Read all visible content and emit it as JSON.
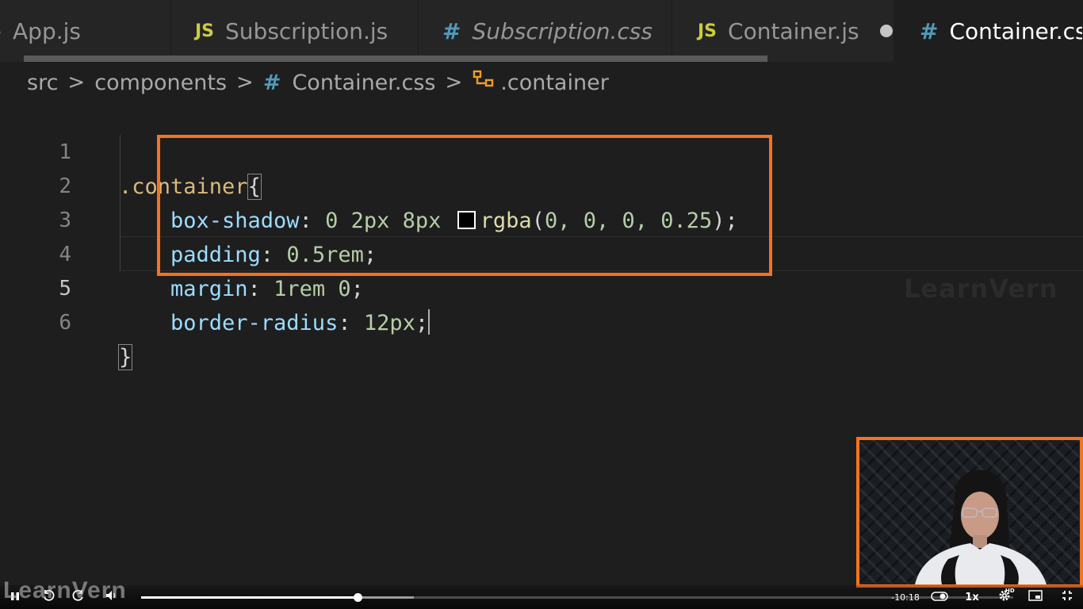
{
  "tabs": [
    {
      "label": "App.js",
      "icon": "js-file-icon",
      "icon_text": "JS",
      "italic": false,
      "active": false,
      "dirty": false
    },
    {
      "label": "Subscription.js",
      "icon": "js-file-icon",
      "icon_text": "JS",
      "italic": false,
      "active": false,
      "dirty": false
    },
    {
      "label": "Subscription.css",
      "icon": "css-file-icon",
      "icon_text": "#",
      "italic": true,
      "active": false,
      "dirty": false
    },
    {
      "label": "Container.js",
      "icon": "js-file-icon",
      "icon_text": "JS",
      "italic": false,
      "active": false,
      "dirty": true
    },
    {
      "label": "Container.css",
      "icon": "css-file-icon",
      "icon_text": "#",
      "italic": false,
      "active": true,
      "dirty": false
    }
  ],
  "breadcrumb": {
    "parts": [
      "src",
      "components",
      "Container.css",
      ".container"
    ],
    "separator": ">",
    "file_icon_text": "#"
  },
  "editor": {
    "line_numbers": [
      "1",
      "2",
      "3",
      "4",
      "5",
      "6"
    ],
    "active_line": "5",
    "lines": {
      "l1_selector": ".container",
      "l1_brace": "{",
      "l2_prop": "box-shadow",
      "l2_colon": ": ",
      "l2_vals": "0 2px 8px",
      "l2_fn": "rgba",
      "l2_open": "(",
      "l2_args": "0, 0, 0, 0.25",
      "l2_close": ")",
      "l2_semi": ";",
      "l3_prop": "padding",
      "l3_colon": ": ",
      "l3_val": "0.5rem",
      "l3_semi": ";",
      "l4_prop": "margin",
      "l4_colon": ": ",
      "l4_val": "1rem 0",
      "l4_semi": ";",
      "l5_prop": "border-radius",
      "l5_colon": ": ",
      "l5_val": "12px",
      "l5_semi": ";",
      "l6_brace": "}"
    },
    "swatch_color": "#000000"
  },
  "watermark": "LearnVern",
  "player": {
    "logo": "LearnVern",
    "time_remaining": "-10:18",
    "speed": "1x",
    "hd_badge": "HD",
    "progress": 0.248,
    "buffered": 0.313
  },
  "colors": {
    "highlight": "#f47321",
    "js_icon": "#cbcb41",
    "css_icon": "#519aba",
    "symbol_icon": "#ee9d28"
  }
}
